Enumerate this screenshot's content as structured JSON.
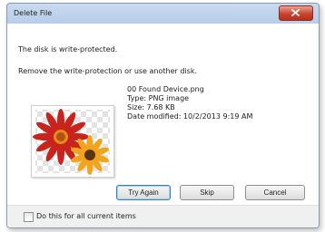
{
  "window": {
    "title": "Delete File"
  },
  "message": {
    "line1": "The disk is write-protected.",
    "line2": "Remove the write-protection or use another disk."
  },
  "file": {
    "name": "00 Found Device.png",
    "type": "Type: PNG image",
    "size": "Size: 7.68 KB",
    "modified": "Date modified: 10/2/2013 9:19 AM"
  },
  "buttons": {
    "try_again": "Try Again",
    "skip": "Skip",
    "cancel": "Cancel"
  },
  "footer": {
    "checkbox_label": "Do this for all current items",
    "checked": false
  },
  "icons": {
    "close": "close-icon",
    "thumbnail": "flower-image"
  },
  "colors": {
    "close_button": "#c9452f",
    "default_button_border": "#3c7fb1"
  }
}
